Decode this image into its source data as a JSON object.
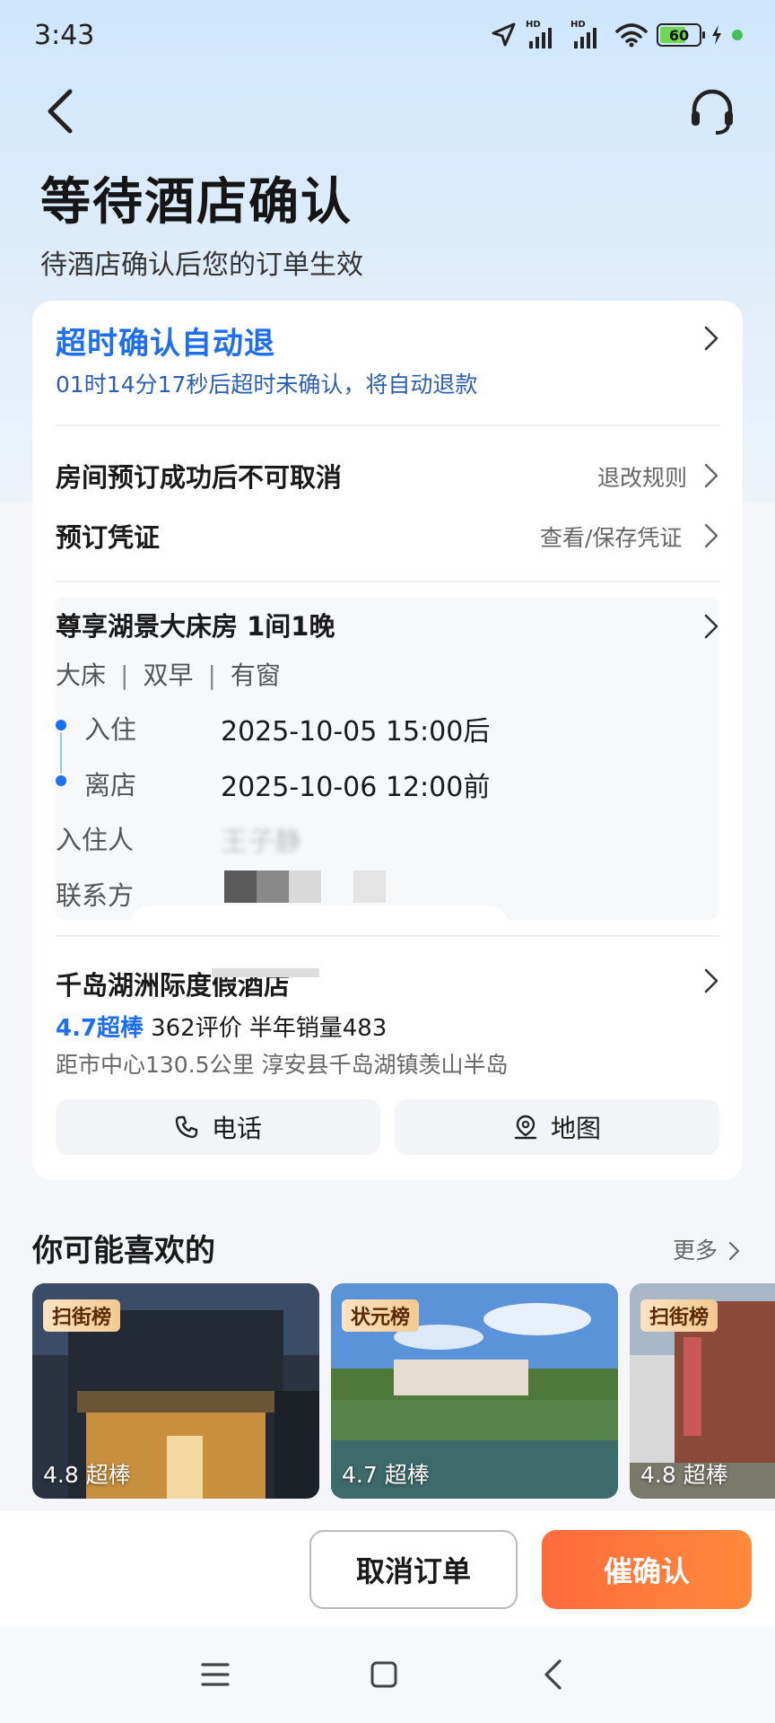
{
  "status_bar": {
    "time": "3:43",
    "battery": "60",
    "signal_label": "HD"
  },
  "header": {
    "title": "等待酒店确认",
    "subtitle": "待酒店确认后您的订单生效"
  },
  "timeout": {
    "title": "超时确认自动退",
    "desc": "01时14分17秒后超时未确认，将自动退款"
  },
  "policy": {
    "label": "房间预订成功后不可取消",
    "link": "退改规则"
  },
  "voucher": {
    "label": "预订凭证",
    "link": "查看/保存凭证"
  },
  "room": {
    "title": "尊享湖景大床房 1间1晚",
    "tags": [
      "大床",
      "双早",
      "有窗"
    ],
    "checkin_label": "入住",
    "checkin_value": "2025-10-05 15:00后",
    "checkout_label": "离店",
    "checkout_value": "2025-10-06 12:00前",
    "guest_label": "入住人",
    "guest_value": "王子静",
    "contact_label": "联系方"
  },
  "hotel": {
    "name": "千岛湖洲际度假酒店",
    "score": "4.7超棒",
    "reviews": "362评价",
    "sales": "半年销量483",
    "address": "距市中心130.5公里  淳安县千岛湖镇羡山半岛",
    "phone_label": "电话",
    "map_label": "地图"
  },
  "recommend": {
    "title": "你可能喜欢的",
    "more": "更多",
    "items": [
      {
        "badge": "扫街榜",
        "score": "4.8 超棒"
      },
      {
        "badge": "状元榜",
        "score": "4.7 超棒"
      },
      {
        "badge": "扫街榜",
        "score": "4.8 超棒"
      }
    ]
  },
  "actions": {
    "cancel": "取消订单",
    "urge": "催确认"
  },
  "colors": {
    "accent_blue": "#1e6ef0",
    "urge_orange": "#ff6a3d"
  }
}
